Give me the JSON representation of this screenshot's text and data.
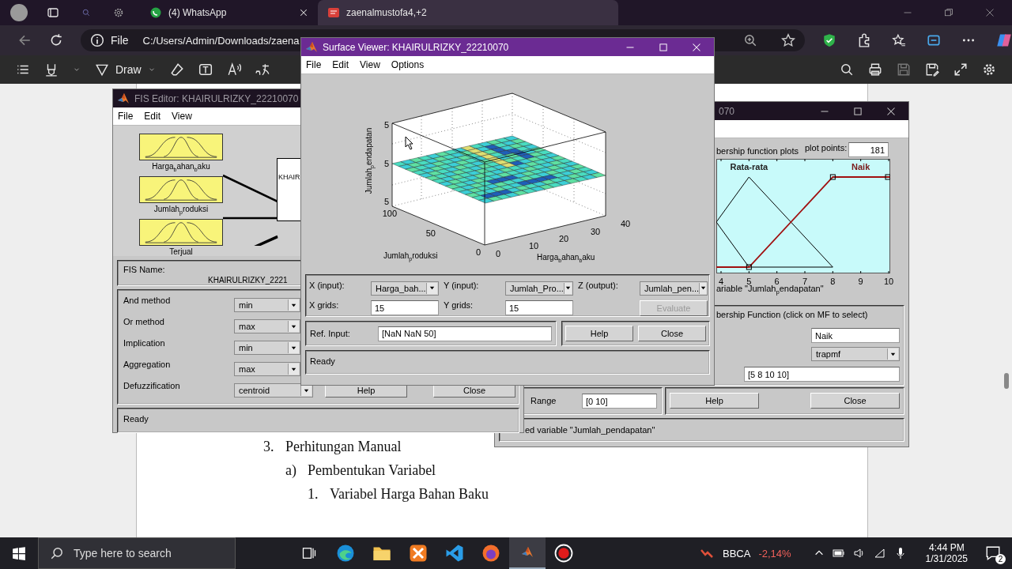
{
  "browser": {
    "tabs": [
      {
        "kind": "whatsapp",
        "title": "(4) WhatsApp",
        "selected": false
      },
      {
        "kind": "pdf",
        "title": "zaenalmustofa4,+2",
        "selected": true
      }
    ],
    "address": {
      "scheme": "File",
      "url": "C:/Users/Admin/Downloads/zaena"
    },
    "pdf_toolbar": {
      "draw_label": "Draw"
    }
  },
  "document": {
    "outline": [
      {
        "marker": "3.",
        "text": "Perhitungan Manual",
        "children": [
          {
            "marker": "a)",
            "text": "Pembentukan Variabel",
            "children": [
              {
                "marker": "1.",
                "text": "Variabel Harga Bahan Baku"
              }
            ]
          }
        ]
      }
    ]
  },
  "mf_editor": {
    "title": "070",
    "plot_heading": "bership function plots",
    "plot_points_label": "plot points:",
    "plot_points": "181",
    "x_ticks": [
      "4",
      "5",
      "6",
      "7",
      "8",
      "9",
      "10"
    ],
    "mf_labels": [
      {
        "text": "Rata-rata",
        "selected": false
      },
      {
        "text": "Naik",
        "selected": true
      }
    ],
    "variable_caption": "ariable \"Jumlah$_{p}$endapatan\"",
    "mf_heading": "bership Function (click on MF to select)",
    "mf_name": "Naik",
    "mf_type": "trapmf",
    "mf_params": "[5 8 10 10]",
    "range_label": "Range",
    "range": "[0 10]",
    "buttons": [
      "Help",
      "Close"
    ],
    "status": "ed variable \"Jumlah_pendapatan\""
  },
  "fis_editor": {
    "title": "FIS Editor: KHAIRULRIZKY_22210070",
    "menu": [
      "File",
      "Edit",
      "View"
    ],
    "inputs": [
      "Harga$_{b}$ahan$_{b}$aku",
      "Jumlah$_{p}$roduksi",
      "Terjual"
    ],
    "system_label": "KHAIR",
    "fis_name_label": "FIS Name:",
    "fis_name": "KHAIRULRIZKY_2221",
    "methods": [
      {
        "label": "And method",
        "value": "min"
      },
      {
        "label": "Or method",
        "value": "max"
      },
      {
        "label": "Implication",
        "value": "min"
      },
      {
        "label": "Aggregation",
        "value": "max"
      },
      {
        "label": "Defuzzification",
        "value": "centroid"
      }
    ],
    "buttons": [
      "Help",
      "Close"
    ],
    "status": "Ready"
  },
  "surface_viewer": {
    "title": "Surface Viewer: KHAIRULRIZKY_22210070",
    "menu": [
      "File",
      "Edit",
      "View",
      "Options"
    ],
    "z_ticks": [
      "5",
      "5",
      "5"
    ],
    "y_ticks": [
      "100",
      "50",
      "0"
    ],
    "x_ticks": [
      "0",
      "10",
      "20",
      "30",
      "40"
    ],
    "z_label": "Jumlah$_{p}$endapatan",
    "y_label": "Jumlah$_{p}$roduksi",
    "x_label": "Harga$_{b}$ahan$_{b}$aku",
    "x_input_label": "X (input):",
    "x_input": "Harga_bah...",
    "y_input_label": "Y (input):",
    "y_input": "Jumlah_Pro...",
    "z_output_label": "Z (output):",
    "z_output": "Jumlah_pen...",
    "x_grids_label": "X grids:",
    "x_grids": "15",
    "y_grids_label": "Y grids:",
    "y_grids": "15",
    "evaluate": {
      "label": "Evaluate",
      "disabled": true
    },
    "ref_input_label": "Ref. Input:",
    "ref_input": "[NaN NaN 50]",
    "buttons": [
      "Help",
      "Close"
    ],
    "status": "Ready"
  },
  "taskbar": {
    "search_placeholder": "Type here to search",
    "apps": [
      {
        "kind": "taskview",
        "selected": false
      },
      {
        "kind": "edge",
        "selected": false
      },
      {
        "kind": "explorer",
        "selected": false
      },
      {
        "kind": "xampp",
        "selected": false
      },
      {
        "kind": "vscode",
        "selected": false
      },
      {
        "kind": "firefox",
        "selected": false
      },
      {
        "kind": "matlab",
        "selected": true
      },
      {
        "kind": "recorder",
        "selected": false
      }
    ],
    "stock_symbol": "BBCA",
    "stock_change": "-2,14%",
    "time": "4:44 PM",
    "date": "1/31/2025",
    "notifications": "2"
  }
}
